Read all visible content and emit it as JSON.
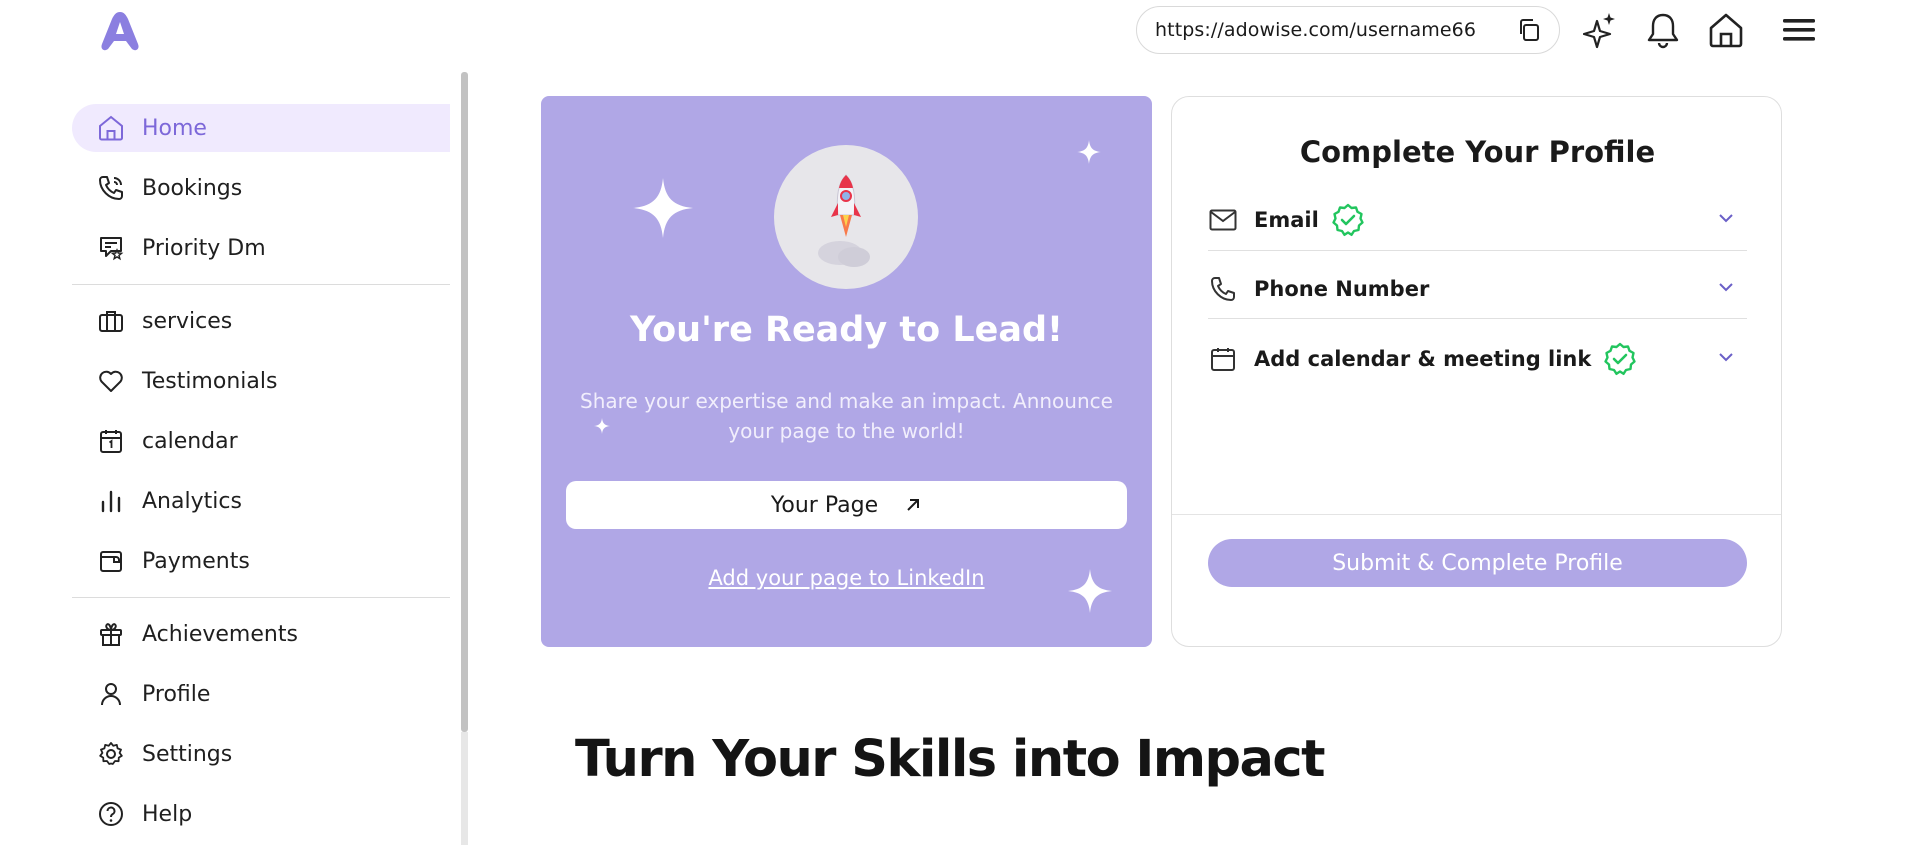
{
  "header": {
    "logo_alt": "A",
    "url": "https://adowise.com/username66",
    "icons": [
      "copy-icon",
      "sparkle-icon",
      "bell-icon",
      "home-icon",
      "menu-icon"
    ]
  },
  "sidebar": {
    "items": [
      {
        "label": "Home",
        "icon": "home-icon",
        "active": true
      },
      {
        "label": "Bookings",
        "icon": "phone-icon"
      },
      {
        "label": "Priority Dm",
        "icon": "message-star-icon"
      },
      {
        "label": "services",
        "icon": "briefcase-icon"
      },
      {
        "label": "Testimonials",
        "icon": "heart-icon"
      },
      {
        "label": "calendar",
        "icon": "calendar-icon"
      },
      {
        "label": "Analytics",
        "icon": "bar-chart-icon"
      },
      {
        "label": "Payments",
        "icon": "wallet-icon"
      },
      {
        "label": "Achievements",
        "icon": "gift-icon"
      },
      {
        "label": "Profile",
        "icon": "user-icon"
      },
      {
        "label": "Settings",
        "icon": "gear-icon"
      },
      {
        "label": "Help",
        "icon": "help-icon"
      }
    ]
  },
  "hero": {
    "title": "You're Ready to Lead!",
    "subtitle": "Share your expertise and make an impact. Announce your page to the world!",
    "button_label": "Your Page",
    "link_label": "Add your page to LinkedIn"
  },
  "profile": {
    "title": "Complete Your Profile",
    "rows": [
      {
        "label": "Email",
        "icon": "mail-icon",
        "verified": true
      },
      {
        "label": "Phone Number",
        "icon": "phone-icon",
        "verified": false
      },
      {
        "label": "Add calendar & meeting link",
        "icon": "calendar-icon",
        "verified": true
      }
    ],
    "submit_label": "Submit & Complete Profile"
  },
  "main": {
    "section_heading": "Turn Your Skills into Impact"
  },
  "colors": {
    "accent": "#7d68d9",
    "hero_bg": "#b0a7e6",
    "active_bg": "#f0eafe",
    "verified": "#22c55e"
  }
}
